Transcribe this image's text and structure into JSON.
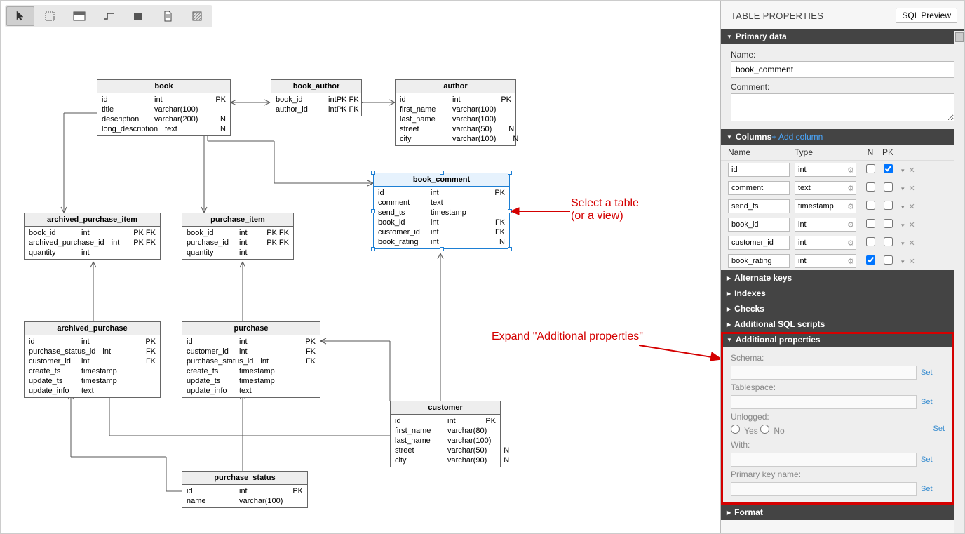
{
  "toolbar": {
    "tools": [
      "cursor",
      "marquee",
      "table",
      "connector",
      "stack",
      "document",
      "hatch"
    ]
  },
  "entities": {
    "book": {
      "title": "book",
      "cols": [
        {
          "n": "id",
          "t": "int",
          "f": "PK"
        },
        {
          "n": "title",
          "t": "varchar(100)",
          "f": ""
        },
        {
          "n": "description",
          "t": "varchar(200)",
          "f": "N"
        },
        {
          "n": "long_description",
          "t": "text",
          "f": "N"
        }
      ]
    },
    "book_author": {
      "title": "book_author",
      "cols": [
        {
          "n": "book_id",
          "t": "int",
          "f": "PK FK"
        },
        {
          "n": "author_id",
          "t": "int",
          "f": "PK FK"
        }
      ]
    },
    "author": {
      "title": "author",
      "cols": [
        {
          "n": "id",
          "t": "int",
          "f": "PK"
        },
        {
          "n": "first_name",
          "t": "varchar(100)",
          "f": ""
        },
        {
          "n": "last_name",
          "t": "varchar(100)",
          "f": ""
        },
        {
          "n": "street",
          "t": "varchar(50)",
          "f": "N"
        },
        {
          "n": "city",
          "t": "varchar(100)",
          "f": "N"
        }
      ]
    },
    "book_comment": {
      "title": "book_comment",
      "cols": [
        {
          "n": "id",
          "t": "int",
          "f": "PK"
        },
        {
          "n": "comment",
          "t": "text",
          "f": ""
        },
        {
          "n": "send_ts",
          "t": "timestamp",
          "f": ""
        },
        {
          "n": "book_id",
          "t": "int",
          "f": "FK"
        },
        {
          "n": "customer_id",
          "t": "int",
          "f": "FK"
        },
        {
          "n": "book_rating",
          "t": "int",
          "f": "N"
        }
      ]
    },
    "archived_purchase_item": {
      "title": "archived_purchase_item",
      "cols": [
        {
          "n": "book_id",
          "t": "int",
          "f": "PK FK"
        },
        {
          "n": "archived_purchase_id",
          "t": "int",
          "f": "PK FK"
        },
        {
          "n": "quantity",
          "t": "int",
          "f": ""
        }
      ]
    },
    "purchase_item": {
      "title": "purchase_item",
      "cols": [
        {
          "n": "book_id",
          "t": "int",
          "f": "PK FK"
        },
        {
          "n": "purchase_id",
          "t": "int",
          "f": "PK FK"
        },
        {
          "n": "quantity",
          "t": "int",
          "f": ""
        }
      ]
    },
    "archived_purchase": {
      "title": "archived_purchase",
      "cols": [
        {
          "n": "id",
          "t": "int",
          "f": "PK"
        },
        {
          "n": "purchase_status_id",
          "t": "int",
          "f": "FK"
        },
        {
          "n": "customer_id",
          "t": "int",
          "f": "FK"
        },
        {
          "n": "create_ts",
          "t": "timestamp",
          "f": ""
        },
        {
          "n": "update_ts",
          "t": "timestamp",
          "f": ""
        },
        {
          "n": "update_info",
          "t": "text",
          "f": ""
        }
      ]
    },
    "purchase": {
      "title": "purchase",
      "cols": [
        {
          "n": "id",
          "t": "int",
          "f": "PK"
        },
        {
          "n": "customer_id",
          "t": "int",
          "f": "FK"
        },
        {
          "n": "purchase_status_id",
          "t": "int",
          "f": "FK"
        },
        {
          "n": "create_ts",
          "t": "timestamp",
          "f": ""
        },
        {
          "n": "update_ts",
          "t": "timestamp",
          "f": ""
        },
        {
          "n": "update_info",
          "t": "text",
          "f": ""
        }
      ]
    },
    "customer": {
      "title": "customer",
      "cols": [
        {
          "n": "id",
          "t": "int",
          "f": "PK"
        },
        {
          "n": "first_name",
          "t": "varchar(80)",
          "f": ""
        },
        {
          "n": "last_name",
          "t": "varchar(100)",
          "f": ""
        },
        {
          "n": "street",
          "t": "varchar(50)",
          "f": "N"
        },
        {
          "n": "city",
          "t": "varchar(90)",
          "f": "N"
        }
      ]
    },
    "purchase_status": {
      "title": "purchase_status",
      "cols": [
        {
          "n": "id",
          "t": "int",
          "f": "PK"
        },
        {
          "n": "name",
          "t": "varchar(100)",
          "f": ""
        }
      ]
    }
  },
  "annotations": {
    "select_table": "Select a table\n(or a view)",
    "expand_additional": "Expand \"Additional properties\""
  },
  "sidebar": {
    "title": "TABLE PROPERTIES",
    "sql_preview": "SQL Preview",
    "primary_data": {
      "head": "Primary data",
      "name_label": "Name:",
      "name_value": "book_comment",
      "comment_label": "Comment:",
      "comment_value": ""
    },
    "columns": {
      "head": "Columns",
      "add": "+ Add column",
      "headers": {
        "name": "Name",
        "type": "Type",
        "n": "N",
        "pk": "PK"
      },
      "rows": [
        {
          "name": "id",
          "type": "int",
          "n": false,
          "pk": true
        },
        {
          "name": "comment",
          "type": "text",
          "n": false,
          "pk": false
        },
        {
          "name": "send_ts",
          "type": "timestamp",
          "n": false,
          "pk": false
        },
        {
          "name": "book_id",
          "type": "int",
          "n": false,
          "pk": false
        },
        {
          "name": "customer_id",
          "type": "int",
          "n": false,
          "pk": false
        },
        {
          "name": "book_rating",
          "type": "int",
          "n": true,
          "pk": false
        }
      ]
    },
    "sections": {
      "alternate_keys": "Alternate keys",
      "indexes": "Indexes",
      "checks": "Checks",
      "additional_sql": "Additional SQL scripts",
      "additional_properties": "Additional properties",
      "format": "Format"
    },
    "additional_properties": {
      "schema_label": "Schema:",
      "tablespace_label": "Tablespace:",
      "unlogged_label": "Unlogged:",
      "yes": "Yes",
      "no": "No",
      "with_label": "With:",
      "pk_name_label": "Primary key name:",
      "set": "Set"
    }
  }
}
